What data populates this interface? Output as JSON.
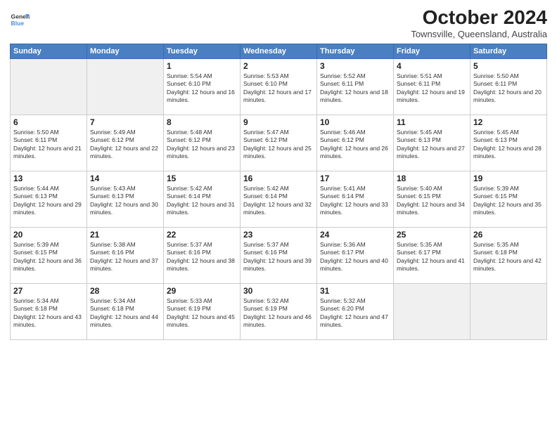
{
  "logo": {
    "line1": "General",
    "line2": "Blue"
  },
  "title": "October 2024",
  "subtitle": "Townsville, Queensland, Australia",
  "days_of_week": [
    "Sunday",
    "Monday",
    "Tuesday",
    "Wednesday",
    "Thursday",
    "Friday",
    "Saturday"
  ],
  "weeks": [
    [
      {
        "day": null,
        "empty": true
      },
      {
        "day": null,
        "empty": true
      },
      {
        "day": "1",
        "sunrise": "5:54 AM",
        "sunset": "6:10 PM",
        "daylight": "12 hours and 16 minutes."
      },
      {
        "day": "2",
        "sunrise": "5:53 AM",
        "sunset": "6:10 PM",
        "daylight": "12 hours and 17 minutes."
      },
      {
        "day": "3",
        "sunrise": "5:52 AM",
        "sunset": "6:11 PM",
        "daylight": "12 hours and 18 minutes."
      },
      {
        "day": "4",
        "sunrise": "5:51 AM",
        "sunset": "6:11 PM",
        "daylight": "12 hours and 19 minutes."
      },
      {
        "day": "5",
        "sunrise": "5:50 AM",
        "sunset": "6:11 PM",
        "daylight": "12 hours and 20 minutes."
      }
    ],
    [
      {
        "day": "6",
        "sunrise": "5:50 AM",
        "sunset": "6:11 PM",
        "daylight": "12 hours and 21 minutes."
      },
      {
        "day": "7",
        "sunrise": "5:49 AM",
        "sunset": "6:12 PM",
        "daylight": "12 hours and 22 minutes."
      },
      {
        "day": "8",
        "sunrise": "5:48 AM",
        "sunset": "6:12 PM",
        "daylight": "12 hours and 23 minutes."
      },
      {
        "day": "9",
        "sunrise": "5:47 AM",
        "sunset": "6:12 PM",
        "daylight": "12 hours and 25 minutes."
      },
      {
        "day": "10",
        "sunrise": "5:46 AM",
        "sunset": "6:12 PM",
        "daylight": "12 hours and 26 minutes."
      },
      {
        "day": "11",
        "sunrise": "5:45 AM",
        "sunset": "6:13 PM",
        "daylight": "12 hours and 27 minutes."
      },
      {
        "day": "12",
        "sunrise": "5:45 AM",
        "sunset": "6:13 PM",
        "daylight": "12 hours and 28 minutes."
      }
    ],
    [
      {
        "day": "13",
        "sunrise": "5:44 AM",
        "sunset": "6:13 PM",
        "daylight": "12 hours and 29 minutes."
      },
      {
        "day": "14",
        "sunrise": "5:43 AM",
        "sunset": "6:13 PM",
        "daylight": "12 hours and 30 minutes."
      },
      {
        "day": "15",
        "sunrise": "5:42 AM",
        "sunset": "6:14 PM",
        "daylight": "12 hours and 31 minutes."
      },
      {
        "day": "16",
        "sunrise": "5:42 AM",
        "sunset": "6:14 PM",
        "daylight": "12 hours and 32 minutes."
      },
      {
        "day": "17",
        "sunrise": "5:41 AM",
        "sunset": "6:14 PM",
        "daylight": "12 hours and 33 minutes."
      },
      {
        "day": "18",
        "sunrise": "5:40 AM",
        "sunset": "6:15 PM",
        "daylight": "12 hours and 34 minutes."
      },
      {
        "day": "19",
        "sunrise": "5:39 AM",
        "sunset": "6:15 PM",
        "daylight": "12 hours and 35 minutes."
      }
    ],
    [
      {
        "day": "20",
        "sunrise": "5:39 AM",
        "sunset": "6:15 PM",
        "daylight": "12 hours and 36 minutes."
      },
      {
        "day": "21",
        "sunrise": "5:38 AM",
        "sunset": "6:16 PM",
        "daylight": "12 hours and 37 minutes."
      },
      {
        "day": "22",
        "sunrise": "5:37 AM",
        "sunset": "6:16 PM",
        "daylight": "12 hours and 38 minutes."
      },
      {
        "day": "23",
        "sunrise": "5:37 AM",
        "sunset": "6:16 PM",
        "daylight": "12 hours and 39 minutes."
      },
      {
        "day": "24",
        "sunrise": "5:36 AM",
        "sunset": "6:17 PM",
        "daylight": "12 hours and 40 minutes."
      },
      {
        "day": "25",
        "sunrise": "5:35 AM",
        "sunset": "6:17 PM",
        "daylight": "12 hours and 41 minutes."
      },
      {
        "day": "26",
        "sunrise": "5:35 AM",
        "sunset": "6:18 PM",
        "daylight": "12 hours and 42 minutes."
      }
    ],
    [
      {
        "day": "27",
        "sunrise": "5:34 AM",
        "sunset": "6:18 PM",
        "daylight": "12 hours and 43 minutes."
      },
      {
        "day": "28",
        "sunrise": "5:34 AM",
        "sunset": "6:18 PM",
        "daylight": "12 hours and 44 minutes."
      },
      {
        "day": "29",
        "sunrise": "5:33 AM",
        "sunset": "6:19 PM",
        "daylight": "12 hours and 45 minutes."
      },
      {
        "day": "30",
        "sunrise": "5:32 AM",
        "sunset": "6:19 PM",
        "daylight": "12 hours and 46 minutes."
      },
      {
        "day": "31",
        "sunrise": "5:32 AM",
        "sunset": "6:20 PM",
        "daylight": "12 hours and 47 minutes."
      },
      {
        "day": null,
        "empty": true
      },
      {
        "day": null,
        "empty": true
      }
    ]
  ],
  "labels": {
    "sunrise_prefix": "Sunrise: ",
    "sunset_prefix": "Sunset: ",
    "daylight_prefix": "Daylight: "
  }
}
